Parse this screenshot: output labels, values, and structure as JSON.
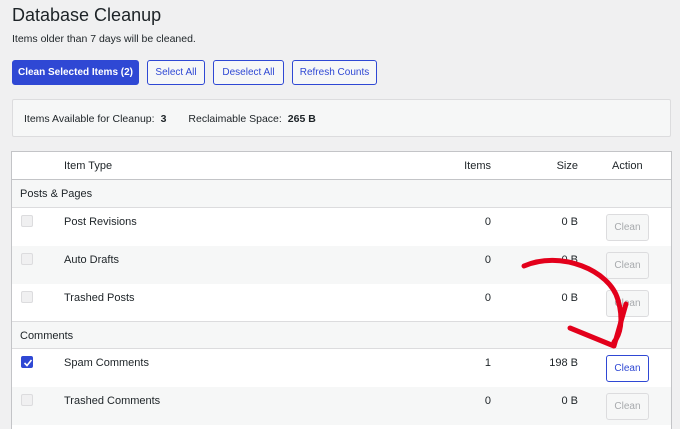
{
  "page": {
    "title": "Database Cleanup",
    "subtitle": "Items older than 7 days will be cleaned."
  },
  "toolbar": {
    "clean_selected": "Clean Selected Items (2)",
    "select_all": "Select All",
    "deselect_all": "Deselect All",
    "refresh": "Refresh Counts"
  },
  "summary": {
    "available_label": "Items Available for Cleanup:",
    "available_value": "3",
    "space_label": "Reclaimable Space:",
    "space_value": "265 B"
  },
  "table": {
    "headers": {
      "type": "Item Type",
      "items": "Items",
      "size": "Size",
      "action": "Action"
    },
    "groups": {
      "posts": "Posts & Pages",
      "comments": "Comments"
    },
    "rows": [
      {
        "type": "Post Revisions",
        "items": "0",
        "size": "0 B",
        "action": "Clean",
        "checked": false
      },
      {
        "type": "Auto Drafts",
        "items": "0",
        "size": "0 B",
        "action": "Clean",
        "checked": false
      },
      {
        "type": "Trashed Posts",
        "items": "0",
        "size": "0 B",
        "action": "Clean",
        "checked": false
      },
      {
        "type": "Spam Comments",
        "items": "1",
        "size": "198 B",
        "action": "Clean",
        "checked": true
      },
      {
        "type": "Trashed Comments",
        "items": "0",
        "size": "0 B",
        "action": "Clean",
        "checked": false
      }
    ]
  },
  "colors": {
    "accent": "#2f48d4",
    "arrow": "#e3001b"
  }
}
